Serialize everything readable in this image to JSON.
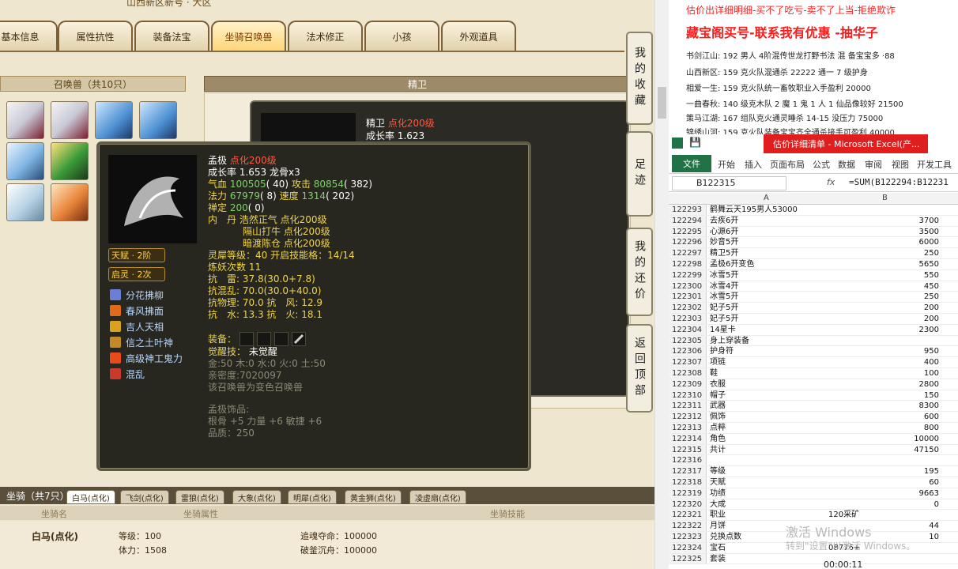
{
  "game": {
    "top_text": "山西新区新号 · 大区",
    "tabs": [
      "基本信息",
      "属性抗性",
      "装备法宝",
      "坐骑召唤兽",
      "法术修正",
      "小孩",
      "外观道具"
    ],
    "summon_header": "召唤兽（共10只）",
    "elite_header": "精卫",
    "back_tip": {
      "name": "精卫",
      "level": "点化200级",
      "growth": "成长率 1.623"
    },
    "tip": {
      "name": "孟极",
      "level": "点化200级",
      "growth": "成长率 1.653 龙骨x3",
      "hp_label": "气血",
      "hp": "100505",
      "hp_rank": "( 40)",
      "atk_label": "攻击",
      "atk": "80854",
      "atk_rank": "( 382)",
      "mp_label": "法力",
      "mp": "67979",
      "mp_rank": "( 8)",
      "spd_label": "速度",
      "spd": "1314",
      "spd_rank": "( 202)",
      "zen_label": "禅定",
      "zen": "200",
      "zen_rank": "( 0)",
      "inner_label": "内　丹",
      "inner1": "浩然正气 点化200级",
      "inner2": "隔山打牛 点化200级",
      "inner3": "暗渡陈仓 点化200级",
      "soul": "灵犀等级：40 开启技能格：14/14",
      "refine": "炼妖次数 11",
      "res1": "抗　雷: 37.8(30.0+7.8)",
      "res2": "抗混乱: 70.0(30.0+40.0)",
      "res3": "抗物理: 70.0 抗　风: 12.9",
      "res4": "抗　水: 13.3 抗　火: 18.1",
      "equip_label": "装备：",
      "awaken_label": "觉醒技：",
      "awaken_value": "未觉醒",
      "elements": "金:50 木:0 水:0 火:0 土:50",
      "intimacy": "亲密度:7020097",
      "color_note": "该召唤兽为变色召唤兽",
      "acc_label": "孟极饰品:",
      "acc_stats": "根骨 +5 力量 +6 敏捷 +6",
      "acc_quality": "品质：250",
      "talent": "天赋 · 2阶",
      "enlight": "启灵 · 2次",
      "skills": [
        "分花拂柳",
        "春风拂面",
        "吉人天相",
        "信之土叶神",
        "高级神工鬼力",
        "混乱"
      ]
    },
    "mount": {
      "title": "坐骑（共7只）",
      "tabs": [
        "白马(点化)",
        "飞剑(点化)",
        "雷狼(点化)",
        "大象(点化)",
        "明犀(点化)",
        "黄金狮(点化)",
        "凌虚扇(点化)"
      ],
      "col_name": "坐骑名",
      "col_attr": "坐骑属性",
      "col_skill": "坐骑技能",
      "name": "白马(点化)",
      "level": "等级：100",
      "stamina": "体力：1508",
      "skill1": "追魂夺命：100000",
      "skill2": "破釜沉舟：100000"
    },
    "side_buttons": [
      "我的收藏",
      "足迹",
      "我的还价",
      "返回顶部"
    ]
  },
  "right": {
    "notice1": "估价出详细明细-买不了吃亏-卖不了上当-拒绝欺诈",
    "notice2": "藏宝阁买号-联系我有优惠 -抽华子",
    "servers": [
      "书剑江山: 192 男人 4阶混传世龙打野书法 混 备宝宝多 ·88",
      "山西新区: 159 克火队混通杀 22222 通一 7 级护身",
      "相爱一生: 159 克火队统一畜牧职业入手盈利 20000",
      "一曲春秋: 140 级克木队 2 魔 1 鬼 1 人 1 仙品像较好 21500",
      "策马江湖: 167 组队克火通灵睡杀 14-15 没压力 75000",
      "锦绣山河: 159 克火队装备宝宝齐全通杀接手可盈利 40000"
    ],
    "excel": {
      "window_title": "估价详细清单 - Microsoft Excel(产...",
      "file_tab": "文件",
      "ribbon": [
        "开始",
        "插入",
        "页面布局",
        "公式",
        "数据",
        "审阅",
        "视图",
        "开发工具"
      ],
      "namebox": "B122315",
      "fx": "fx",
      "formula": "=SUM(B122294:B12231",
      "col_a": "A",
      "col_b": "B",
      "rows": [
        [
          "122293",
          "鹤舞云天195男人53000",
          ""
        ],
        [
          "122294",
          "去疾6开",
          "3700"
        ],
        [
          "122295",
          "心源6开",
          "3500"
        ],
        [
          "122296",
          "妙音5开",
          "6000"
        ],
        [
          "122297",
          "精卫5开",
          "250"
        ],
        [
          "122298",
          "孟极6开变色",
          "5650"
        ],
        [
          "122299",
          "冰雪5开",
          "550"
        ],
        [
          "122300",
          "冰雪4开",
          "450"
        ],
        [
          "122301",
          "冰雪5开",
          "250"
        ],
        [
          "122302",
          "妃子5开",
          "200"
        ],
        [
          "122303",
          "妃子5开",
          "200"
        ],
        [
          "122304",
          "14星卡",
          "2300"
        ],
        [
          "122305",
          "身上穿装备",
          ""
        ],
        [
          "122306",
          "护身符",
          "950"
        ],
        [
          "122307",
          "项链",
          "400"
        ],
        [
          "122308",
          "鞋",
          "100"
        ],
        [
          "122309",
          "衣服",
          "2800"
        ],
        [
          "122310",
          "帽子",
          "150"
        ],
        [
          "122311",
          "武器",
          "8300"
        ],
        [
          "122312",
          "佩饰",
          "600"
        ],
        [
          "122313",
          "点粹",
          "800"
        ],
        [
          "122314",
          "角色",
          "10000"
        ],
        [
          "122315",
          "共计",
          "47150"
        ],
        [
          "122316",
          "",
          ""
        ],
        [
          "122317",
          "等级",
          "195"
        ],
        [
          "122318",
          "天赋",
          "60"
        ],
        [
          "122319",
          "功绩",
          "9663"
        ],
        [
          "122320",
          "大成",
          "0"
        ],
        [
          "122321",
          "职业",
          "120采矿"
        ],
        [
          "122322",
          "月饼",
          "44"
        ],
        [
          "122323",
          "兑换点数",
          "10"
        ],
        [
          "122324",
          "宝石",
          "08776+"
        ],
        [
          "122325",
          "套装",
          ""
        ]
      ],
      "watermark": "激活 Windows",
      "watermark_sub": "转到\"设置\"以激活 Windows。",
      "timer": "00:00:11"
    }
  }
}
